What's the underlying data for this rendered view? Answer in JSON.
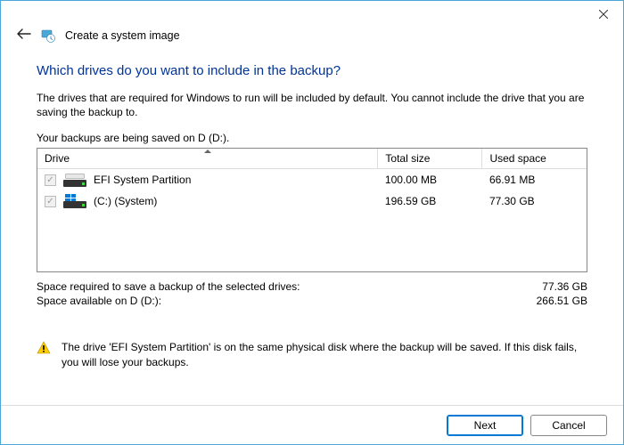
{
  "window": {
    "title": "Create a system image"
  },
  "heading": "Which drives do you want to include in the backup?",
  "subtext": "The drives that are required for Windows to run will be included by default. You cannot include the drive that you are saving the backup to.",
  "save_location": "Your backups are being saved on D (D:).",
  "columns": {
    "drive": "Drive",
    "total": "Total size",
    "used": "Used space"
  },
  "drives": [
    {
      "name": "EFI System Partition",
      "total": "100.00 MB",
      "used": "66.91 MB"
    },
    {
      "name": "(C:) (System)",
      "total": "196.59 GB",
      "used": "77.30 GB"
    }
  ],
  "summary": {
    "required_label": "Space required to save a backup of the selected drives:",
    "required_value": "77.36 GB",
    "available_label": "Space available on D (D:):",
    "available_value": "266.51 GB"
  },
  "warning": "The drive 'EFI System Partition' is on the same physical disk where the backup will be saved. If this disk fails, you will lose your backups.",
  "buttons": {
    "next": "Next",
    "cancel": "Cancel"
  }
}
